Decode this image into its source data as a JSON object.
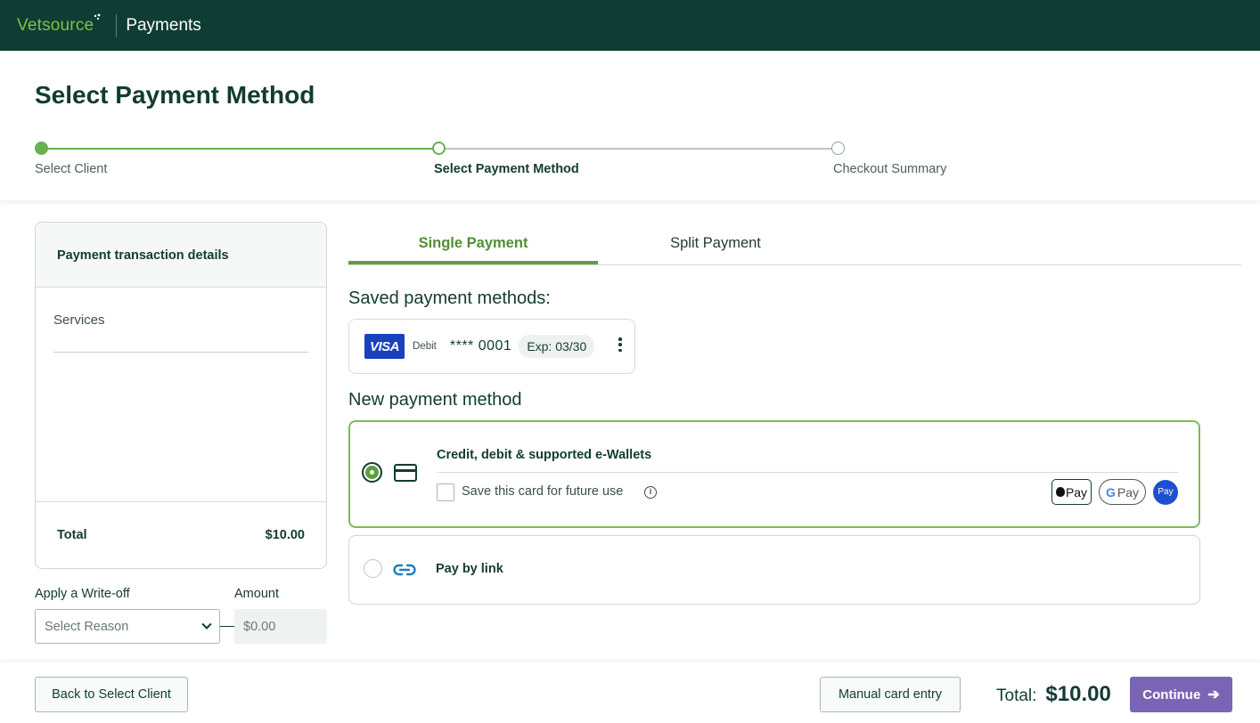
{
  "topbar": {
    "brand": "Vetsource",
    "product": "Payments"
  },
  "header": {
    "title": "Select Payment Method",
    "steps": [
      {
        "label": "Select Client",
        "state": "complete"
      },
      {
        "label": "Select Payment Method",
        "state": "current"
      },
      {
        "label": "Checkout Summary",
        "state": "upcoming"
      }
    ]
  },
  "details": {
    "title": "Payment transaction details",
    "services_label": "Services",
    "total_label": "Total",
    "total_value": "$10.00"
  },
  "writeoff": {
    "reason_label": "Apply a Write-off",
    "reason_placeholder": "Select Reason",
    "amount_label": "Amount",
    "amount_placeholder": "$0.00"
  },
  "tabs": [
    {
      "label": "Single Payment",
      "active": true
    },
    {
      "label": "Split Payment",
      "active": false
    }
  ],
  "saved": {
    "title": "Saved payment methods:",
    "card": {
      "brand": "VISA",
      "type": "Debit",
      "number": "**** 0001",
      "expiry": "Exp: 03/30"
    }
  },
  "new_method": {
    "title": "New payment method",
    "card_option": {
      "title": "Credit, debit & supported e-Wallets",
      "selected": true,
      "save_label": "Save this card for future use",
      "save_checked": false,
      "wallets": {
        "apple": "Pay",
        "google": "Pay",
        "samsung": "Pay"
      }
    },
    "link_option": {
      "title": "Pay by link",
      "selected": false
    }
  },
  "footer": {
    "back_label": "Back to Select Client",
    "manual_label": "Manual card entry",
    "total_label": "Total:",
    "total_value": "$10.00",
    "continue_label": "Continue"
  },
  "colors": {
    "topbar": "#0f3d34",
    "accent_green": "#5f9d3f",
    "continue": "#7a65b5"
  },
  "icons": [
    "card-icon",
    "link-icon",
    "info-icon",
    "chevron-down-icon",
    "kebab-icon",
    "arrow-right-icon"
  ]
}
